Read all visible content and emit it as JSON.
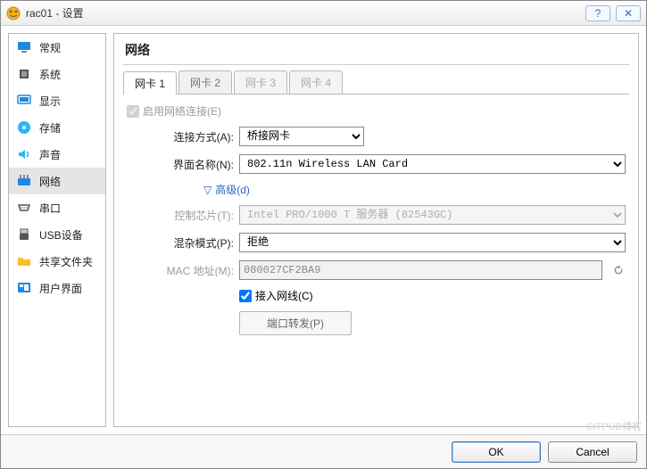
{
  "window": {
    "title": "rac01 - 设置"
  },
  "sidebar": {
    "items": [
      {
        "label": "常规",
        "icon": "#1e88e5"
      },
      {
        "label": "系统",
        "icon": "#555"
      },
      {
        "label": "显示",
        "icon": "#1e88e5"
      },
      {
        "label": "存储",
        "icon": "#29b6f6"
      },
      {
        "label": "声音",
        "icon": "#29b6f6"
      },
      {
        "label": "网络",
        "icon": "#1e88e5"
      },
      {
        "label": "串口",
        "icon": "#555"
      },
      {
        "label": "USB设备",
        "icon": "#555"
      },
      {
        "label": "共享文件夹",
        "icon": "#fbc02d"
      },
      {
        "label": "用户界面",
        "icon": "#1e88e5"
      }
    ],
    "active_index": 5
  },
  "header": {
    "title": "网络"
  },
  "tabs": [
    {
      "label": "网卡 1",
      "active": true,
      "disabled": false
    },
    {
      "label": "网卡 2",
      "active": false,
      "disabled": false
    },
    {
      "label": "网卡 3",
      "active": false,
      "disabled": true
    },
    {
      "label": "网卡 4",
      "active": false,
      "disabled": true
    }
  ],
  "form": {
    "enable": {
      "label": "启用网络连接(E)",
      "checked": true
    },
    "attached": {
      "label": "连接方式(A):",
      "value": "桥接网卡"
    },
    "interface": {
      "label": "界面名称(N):",
      "value": "802.11n Wireless LAN Card"
    },
    "advanced_label": "高级(d)",
    "chipset": {
      "label": "控制芯片(T):",
      "value": "Intel PRO/1000 T 服务器 (82543GC)"
    },
    "promiscuous": {
      "label": "混杂模式(P):",
      "value": "拒绝"
    },
    "mac": {
      "label": "MAC 地址(M):",
      "value": "080027CF2BA9"
    },
    "cable": {
      "label": "接入网线(C)",
      "checked": true
    },
    "port_forward": {
      "label": "端口转发(P)"
    }
  },
  "footer": {
    "ok": "OK",
    "cancel": "Cancel"
  },
  "watermark": "©ITPUB博客"
}
